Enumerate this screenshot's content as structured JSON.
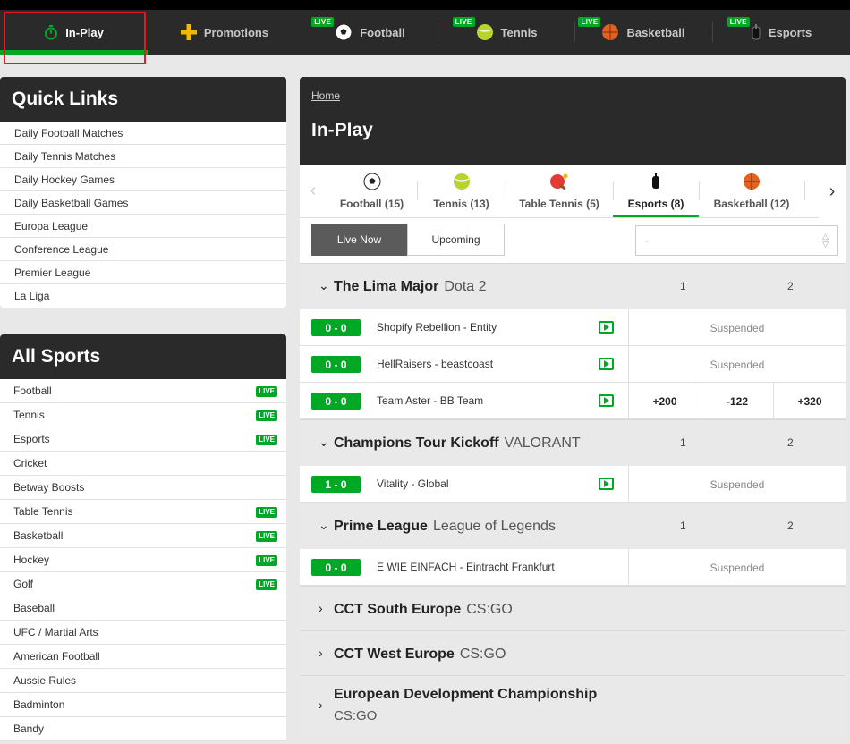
{
  "topnav": {
    "items": [
      {
        "label": "In-Play",
        "icon": "stopwatch-icon",
        "live": false,
        "active": true
      },
      {
        "label": "Promotions",
        "icon": "plus-icon",
        "live": false,
        "active": false
      },
      {
        "label": "Football",
        "icon": "football-icon",
        "live": true,
        "active": false
      },
      {
        "label": "Tennis",
        "icon": "tennis-ball-icon",
        "live": true,
        "active": false
      },
      {
        "label": "Basketball",
        "icon": "basketball-icon",
        "live": true,
        "active": false
      },
      {
        "label": "Esports",
        "icon": "joystick-icon",
        "live": true,
        "active": false
      }
    ],
    "live_label": "LIVE"
  },
  "quick_links": {
    "title": "Quick Links",
    "items": [
      "Daily Football Matches",
      "Daily Tennis Matches",
      "Daily Hockey Games",
      "Daily Basketball Games",
      "Europa League",
      "Conference League",
      "Premier League",
      "La Liga"
    ]
  },
  "all_sports": {
    "title": "All Sports",
    "live_label": "LIVE",
    "items": [
      {
        "label": "Football",
        "live": true
      },
      {
        "label": "Tennis",
        "live": true
      },
      {
        "label": "Esports",
        "live": true
      },
      {
        "label": "Cricket",
        "live": false
      },
      {
        "label": "Betway Boosts",
        "live": false
      },
      {
        "label": "Table Tennis",
        "live": true
      },
      {
        "label": "Basketball",
        "live": true
      },
      {
        "label": "Hockey",
        "live": true
      },
      {
        "label": "Golf",
        "live": true
      },
      {
        "label": "Baseball",
        "live": false
      },
      {
        "label": "UFC / Martial Arts",
        "live": false
      },
      {
        "label": "American Football",
        "live": false
      },
      {
        "label": "Aussie Rules",
        "live": false
      },
      {
        "label": "Badminton",
        "live": false
      },
      {
        "label": "Bandy",
        "live": false
      }
    ]
  },
  "main": {
    "breadcrumb": "Home",
    "title": "In-Play",
    "sport_tabs": [
      {
        "label": "Football (15)",
        "icon": "football-icon",
        "active": false
      },
      {
        "label": "Tennis (13)",
        "icon": "tennis-ball-icon",
        "active": false
      },
      {
        "label": "Table Tennis (5)",
        "icon": "ping-pong-icon",
        "active": false
      },
      {
        "label": "Esports (8)",
        "icon": "joystick-icon",
        "active": true
      },
      {
        "label": "Basketball (12)",
        "icon": "basketball-icon",
        "active": false
      }
    ],
    "filter": {
      "live_now": "Live Now",
      "upcoming": "Upcoming",
      "select_value": "-"
    },
    "leagues": [
      {
        "name": "The Lima Major",
        "game": "Dota 2",
        "expanded": true,
        "col1": "1",
        "col2": "2",
        "matches": [
          {
            "score": "0 - 0",
            "teams": "Shopify Rebellion  - Entity",
            "status": "Suspended",
            "odds": []
          },
          {
            "score": "0 - 0",
            "teams": "HellRaisers  - beastcoast",
            "status": "Suspended",
            "odds": []
          },
          {
            "score": "0 - 0",
            "teams": "Team Aster  - BB Team",
            "status": "",
            "odds": [
              "+200",
              "-122",
              "+320"
            ]
          }
        ]
      },
      {
        "name": "Champions Tour Kickoff",
        "game": "VALORANT",
        "expanded": true,
        "col1": "1",
        "col2": "2",
        "matches": [
          {
            "score": "1 - 0",
            "teams": "Vitality  - Global",
            "status": "Suspended",
            "odds": []
          }
        ]
      },
      {
        "name": "Prime League",
        "game": "League of Legends",
        "expanded": true,
        "col1": "1",
        "col2": "2",
        "matches": [
          {
            "score": "0 - 0",
            "teams": "E WIE EINFACH  - Eintracht Frankfurt",
            "status": "Suspended",
            "odds": []
          }
        ]
      },
      {
        "name": "CCT South Europe",
        "game": "CS:GO",
        "expanded": false
      },
      {
        "name": "CCT West Europe",
        "game": "CS:GO",
        "expanded": false
      },
      {
        "name": "European Development Championship",
        "game": "CS:GO",
        "expanded": false,
        "tall": true
      }
    ]
  },
  "colors": {
    "accent": "#00a826",
    "dark": "#2a2a2a",
    "highlight": "#e01b24"
  }
}
